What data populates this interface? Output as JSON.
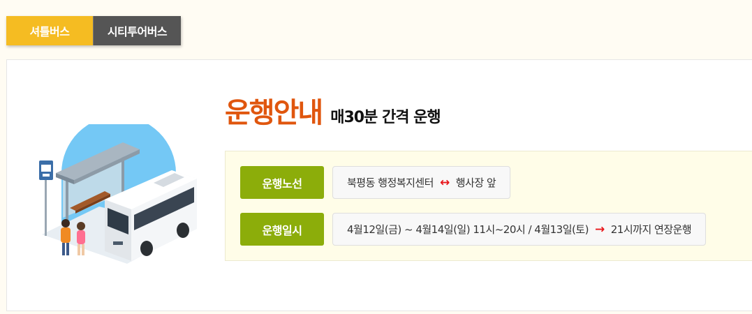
{
  "tabs": [
    {
      "label": "셔틀버스",
      "active": true
    },
    {
      "label": "시티투어버스",
      "active": false
    }
  ],
  "heading": {
    "title": "운행안내",
    "subtitle": "매30분 간격 운행"
  },
  "rows": [
    {
      "label": "운행노선",
      "value_before": "북평동 행정복지센터",
      "arrow_icon": "double-arrow-icon",
      "value_after": "행사장 앞"
    },
    {
      "label": "운행일시",
      "value_before": "4월12일(금) ~ 4월14일(일) 11시~20시 / 4월13일(토)",
      "arrow_icon": "right-arrow-icon",
      "value_after": "21시까지 연장운행"
    }
  ],
  "colors": {
    "tab_active": "#f5bc22",
    "tab_inactive": "#555555",
    "heading_accent": "#e0560e",
    "label_green": "#8cad0a",
    "arrow_red": "#e8171b",
    "infobox_bg": "#fffde8"
  }
}
